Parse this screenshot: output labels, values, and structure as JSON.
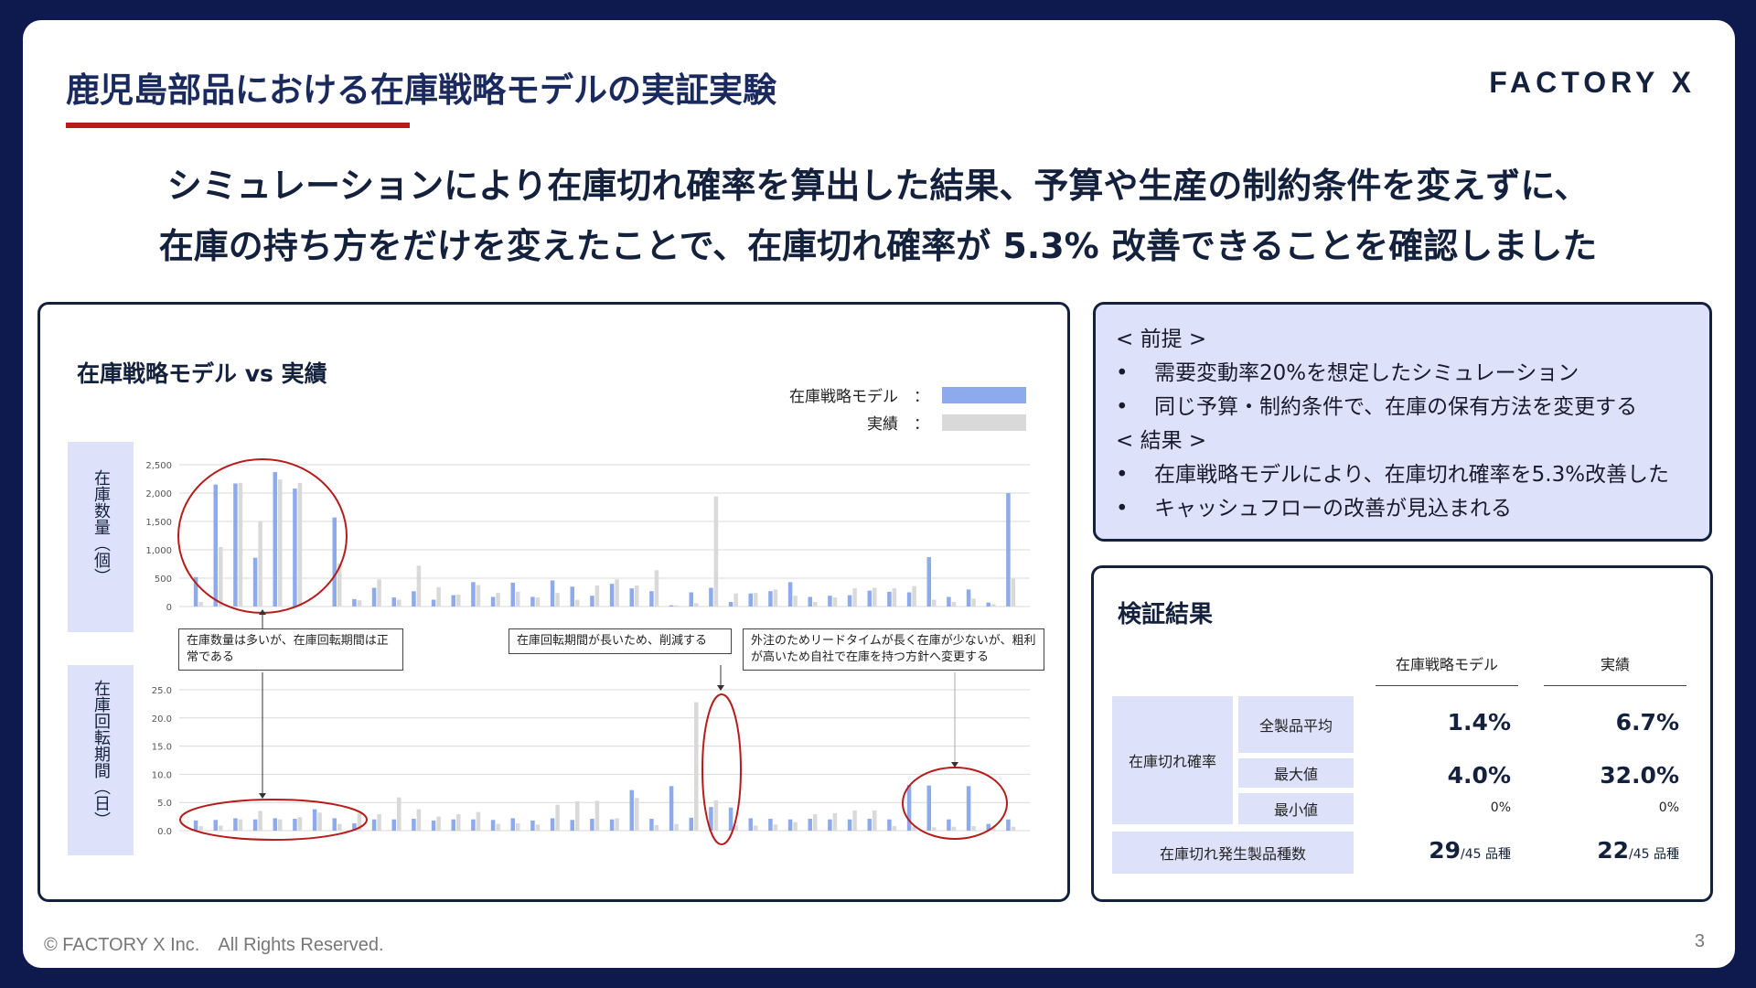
{
  "title": "鹿児島部品における在庫戦略モデルの実証実験",
  "logo": "FACTORY X",
  "headline": {
    "line1": "シミュレーションにより在庫切れ確率を算出した結果、予算や生産の制約条件を変えずに、",
    "line2": "在庫の持ち方をだけを変えたことで、在庫切れ確率が 5.3% 改善できることを確認しました"
  },
  "colors": {
    "model": "#8daaed",
    "actual": "#d9d9d9",
    "accent_red": "#b71c1c",
    "navy": "#14213d",
    "panel_bg": "#dde2fa"
  },
  "chart_title": "在庫戦略モデル vs 実績",
  "legend": {
    "model_label": "在庫戦略モデル　：",
    "actual_label": "実績　："
  },
  "ylabels": {
    "top": "在庫数量（個）",
    "bottom": "在庫回転期間（日）"
  },
  "callouts": {
    "c1": "在庫数量は多いが、在庫回転期間は正常である",
    "c2": "在庫回転期間が長いため、削減する",
    "c3": "外注のためリードタイムが長く在庫が少ないが、粗利が高いため自社で在庫を持つ方針へ変更する"
  },
  "chart_data": [
    {
      "type": "bar",
      "ylabel": "在庫数量（個）",
      "ylim": [
        0,
        2500
      ],
      "yticks": [
        "0",
        "500",
        "1,000",
        "1,500",
        "2,000",
        "2,500"
      ],
      "series": [
        {
          "name": "在庫戦略モデル",
          "values": [
            520,
            2150,
            2170,
            860,
            2370,
            2080,
            0,
            1570,
            130,
            330,
            160,
            270,
            120,
            200,
            430,
            170,
            420,
            170,
            460,
            350,
            190,
            400,
            320,
            270,
            20,
            250,
            330,
            80,
            230,
            270,
            430,
            170,
            190,
            200,
            280,
            260,
            250,
            870,
            170,
            300,
            70,
            2000
          ]
        },
        {
          "name": "実績",
          "values": [
            80,
            1050,
            2180,
            1510,
            2240,
            2180,
            0,
            760,
            110,
            480,
            120,
            720,
            340,
            210,
            380,
            240,
            260,
            160,
            240,
            120,
            370,
            480,
            370,
            640,
            20,
            60,
            1940,
            230,
            240,
            300,
            190,
            80,
            160,
            320,
            330,
            320,
            360,
            120,
            80,
            140,
            40,
            490
          ]
        }
      ]
    },
    {
      "type": "bar",
      "ylabel": "在庫回転期間（日）",
      "ylim": [
        0,
        25
      ],
      "yticks": [
        "0.0",
        "5.0",
        "10.0",
        "15.0",
        "20.0",
        "25.0"
      ],
      "series": [
        {
          "name": "在庫戦略モデル",
          "values": [
            1.8,
            1.9,
            2.2,
            2.0,
            2.2,
            2.1,
            3.8,
            2.2,
            1.3,
            2.0,
            2.0,
            2.1,
            1.8,
            2.0,
            2.0,
            1.9,
            2.2,
            1.8,
            2.2,
            1.9,
            2.1,
            2.0,
            7.2,
            2.1,
            7.9,
            2.3,
            4.2,
            4.1,
            2.2,
            2.1,
            2.0,
            2.1,
            2.0,
            2.0,
            2.1,
            2.0,
            8.1,
            8.0,
            2.0,
            7.9,
            1.2,
            2.0
          ]
        },
        {
          "name": "実績",
          "values": [
            0.8,
            0.9,
            2.0,
            3.5,
            2.0,
            2.4,
            3.2,
            1.2,
            3.1,
            2.9,
            5.9,
            3.8,
            2.5,
            2.9,
            3.3,
            1.2,
            1.3,
            1.1,
            4.6,
            5.2,
            5.3,
            2.2,
            5.8,
            1.0,
            1.2,
            22.8,
            5.4,
            1.0,
            0.9,
            1.1,
            1.5,
            2.9,
            3.1,
            3.6,
            3.6,
            0.8,
            0.7,
            0.6,
            0.7,
            0.8,
            0.6,
            0.7
          ]
        }
      ]
    }
  ],
  "premise": {
    "h1": "< 前提 >",
    "i1": "需要変動率20%を想定したシミュレーション",
    "i2": "同じ予算・制約条件で、在庫の保有方法を変更する",
    "h2": "< 結果 >",
    "i3": "在庫戦略モデルにより、在庫切れ確率を5.3%改善した",
    "i4": "キャッシュフローの改善が見込まれる"
  },
  "verify": {
    "title": "検証結果",
    "col_model": "在庫戦略モデル",
    "col_actual": "実績",
    "row_group": "在庫切れ確率",
    "avg_label": "全製品平均",
    "max_label": "最大値",
    "min_label": "最小値",
    "count_label": "在庫切れ発生製品種数",
    "model": {
      "avg": "1.4%",
      "max": "4.0%",
      "min": "0%",
      "count": "29",
      "count_suffix": "/45 品種"
    },
    "actual": {
      "avg": "6.7%",
      "max": "32.0%",
      "min": "0%",
      "count": "22",
      "count_suffix": "/45 品種"
    }
  },
  "footer": "© FACTORY X Inc.　All Rights Reserved.",
  "page_number": "3"
}
